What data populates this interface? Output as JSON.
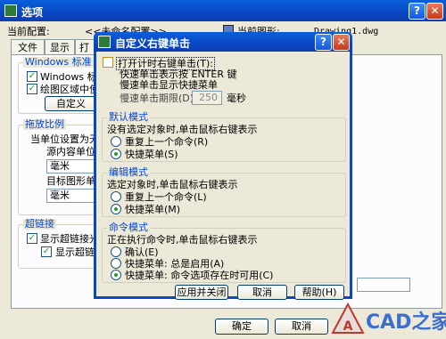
{
  "main_dialog": {
    "title": "选项",
    "current_config_label": "当前配置:",
    "current_config_value": "<<未命名配置>>",
    "current_drawing_label": "当前图形:",
    "current_drawing_value": "Drawing1.dwg",
    "tabs": [
      "文件",
      "显示",
      "打"
    ],
    "windows_standard_group": "Windows 标准",
    "windows_std_opt1": "Windows 标准加",
    "windows_std_opt2": "绘图区域中使用",
    "custom_button_partial": "自定义",
    "scale_group": "拖放比例",
    "unit_setting_label": "当单位设置为无单",
    "source_unit_label": "源内容单位",
    "source_unit_value": "毫米",
    "target_unit_label": "目标图形单位",
    "target_unit_value": "毫米",
    "hyperlink_group": "超链接",
    "hyperlink_opt1": "显示超链接光标",
    "hyperlink_opt2": "显示超链",
    "ok_button": "确定",
    "cancel_button": "取消"
  },
  "sub_dialog": {
    "title": "自定义右键单击",
    "timed_right_click": "打开计时右键单击(T):",
    "quick_click_line1": "快速单击表示按 ENTER 键",
    "quick_click_line2": "慢速单击显示快捷菜单",
    "slow_click_label": "慢速单击期限(D):",
    "slow_click_value": "250",
    "slow_click_unit": "毫秒",
    "default_mode": {
      "title": "默认模式",
      "desc": "没有选定对象时,单击鼠标右键表示",
      "options": [
        "重复上一个命令(R)",
        "快捷菜单(S)"
      ],
      "selected": 1
    },
    "edit_mode": {
      "title": "编辑模式",
      "desc": "选定对象时,单击鼠标右键表示",
      "options": [
        "重复上一个命令(L)",
        "快捷菜单(M)"
      ],
      "selected": 1
    },
    "command_mode": {
      "title": "命令模式",
      "desc": "正在执行命令时,单击鼠标右键表示",
      "options": [
        "确认(E)",
        "快捷菜单: 总是启用(A)",
        "快捷菜单: 命令选项存在时可用(C)"
      ],
      "selected": 2
    },
    "apply_close_button": "应用并关闭",
    "cancel_button": "取消",
    "help_button": "帮助(H)"
  },
  "watermark": "CAD之家"
}
